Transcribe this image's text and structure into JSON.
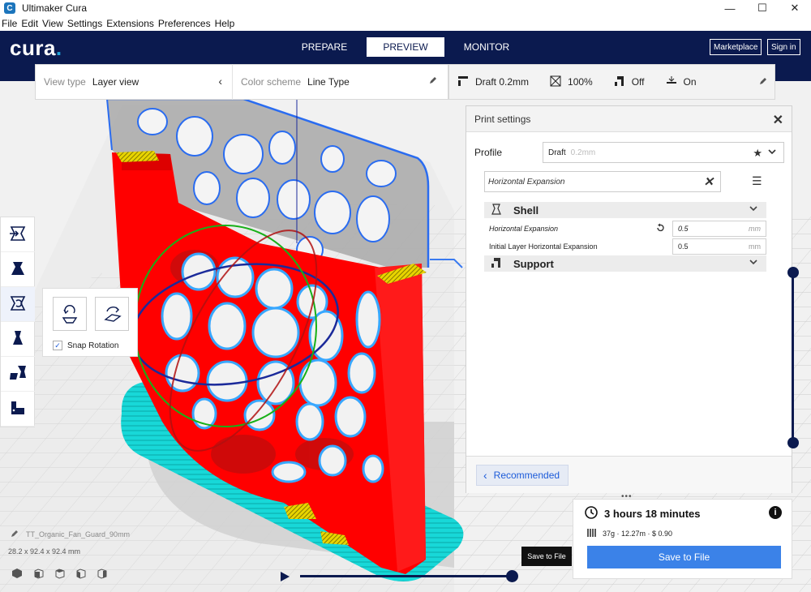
{
  "window": {
    "title": "Ultimaker Cura",
    "app_icon": "cura-icon"
  },
  "menu": [
    "File",
    "Edit",
    "View",
    "Settings",
    "Extensions",
    "Preferences",
    "Help"
  ],
  "header": {
    "logo": "cura",
    "tabs": [
      {
        "label": "PREPARE",
        "active": false
      },
      {
        "label": "PREVIEW",
        "active": true
      },
      {
        "label": "MONITOR",
        "active": false
      }
    ],
    "marketplace": "Marketplace",
    "sign_in": "Sign in"
  },
  "toolbar": {
    "view_type_label": "View type",
    "view_type_value": "Layer view",
    "color_scheme_label": "Color scheme",
    "color_scheme_value": "Line Type",
    "profile": "Draft 0.2mm",
    "infill": "100%",
    "support": "Off",
    "adhesion": "On"
  },
  "rotate_panel": {
    "snap_label": "Snap Rotation",
    "snap_checked": true
  },
  "print_settings": {
    "title": "Print settings",
    "profile_label": "Profile",
    "profile_value": "Draft",
    "profile_sub": "0.2mm",
    "search_value": "Horizontal Expansion",
    "categories": [
      {
        "name": "Shell",
        "settings": [
          {
            "label": "Horizontal Expansion",
            "value": "0.5",
            "unit": "mm"
          },
          {
            "label": "Initial Layer Horizontal Expansion",
            "value": "0.5",
            "unit": "mm"
          }
        ]
      },
      {
        "name": "Support"
      }
    ],
    "recommended_button": "Recommended"
  },
  "output": {
    "time": "3 hours 18 minutes",
    "material": "37g · 12.27m · $ 0.90",
    "save_button": "Save to File",
    "tooltip": "Save to File"
  },
  "object": {
    "name": "TT_Organic_Fan_Guard_90mm",
    "dims": "28.2 x 92.4 x 92.4 mm"
  },
  "layer_slider": {
    "top_fraction": 1.0,
    "bottom_fraction": 0.0
  },
  "playback_slider": {
    "fraction": 1.0
  },
  "colors": {
    "header_bg": "#0b1a4f",
    "accent_blue": "#3b82e8",
    "wall_red": "#ff0000",
    "skirt_cyan": "#18d8d8",
    "infill_yellow": "#e8d400"
  }
}
